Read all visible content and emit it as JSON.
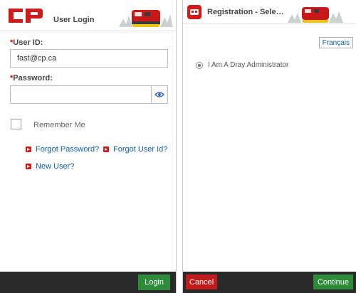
{
  "login": {
    "title": "User Login",
    "user_id_label": "User ID:",
    "user_id_value": "fast@cp.ca",
    "password_label": "Password:",
    "password_value": "",
    "remember_me": "Remember Me",
    "links": {
      "forgot_password": "Forgot Password?",
      "forgot_user_id": "Forgot User Id?",
      "new_user": "New User?"
    },
    "login_button": "Login"
  },
  "registration": {
    "title": "Registration - Sele…",
    "language_button": "Français",
    "option_label": "I Am A Dray Administrator",
    "cancel_button": "Cancel",
    "continue_button": "Continue"
  },
  "brand": {
    "logo_text": "CP",
    "accent": "#d11a1a",
    "link": "#0b5ea8",
    "success": "#2e8b3a",
    "footer": "#2b2b2b"
  }
}
